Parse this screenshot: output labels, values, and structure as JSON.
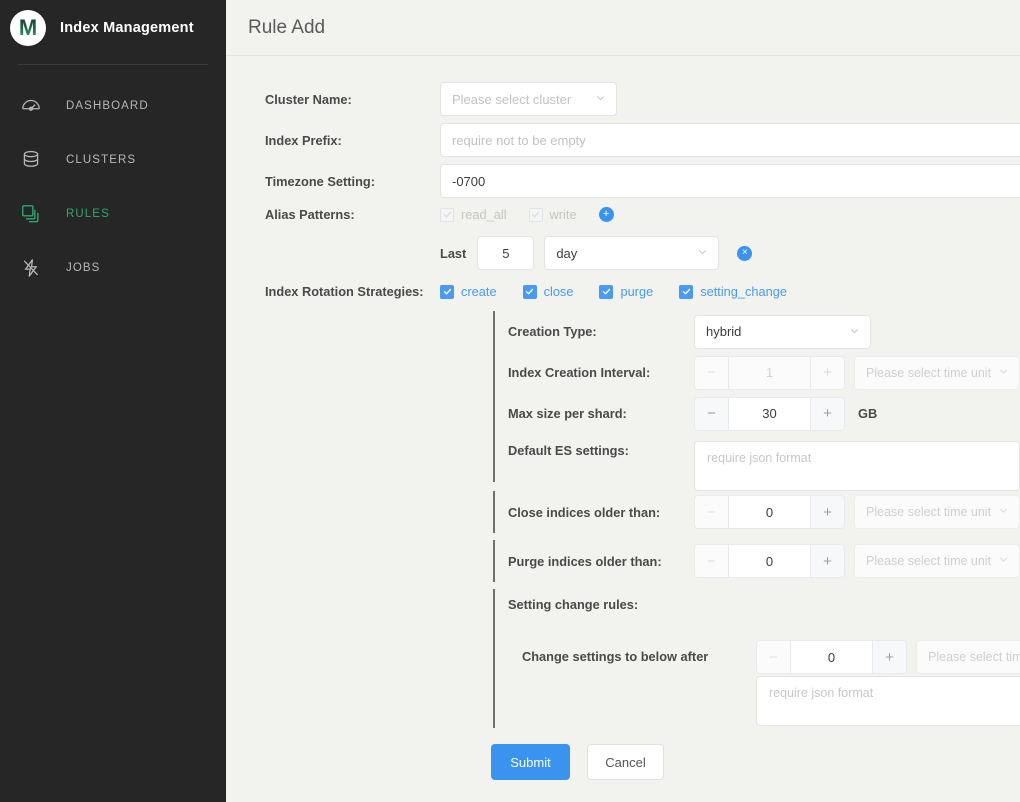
{
  "sidebar": {
    "brand": {
      "logo_letter": "M",
      "title": "Index Management"
    },
    "items": [
      {
        "label": "DASHBOARD",
        "icon": "gauge-icon",
        "active": false
      },
      {
        "label": "CLUSTERS",
        "icon": "database-icon",
        "active": false
      },
      {
        "label": "RULES",
        "icon": "stacked-squares-icon",
        "active": true
      },
      {
        "label": "JOBS",
        "icon": "lightning-bolt-icon",
        "active": false
      }
    ],
    "active_color": "#2ea86e",
    "background": "#262626"
  },
  "header": {
    "title": "Rule Add"
  },
  "form": {
    "cluster_name": {
      "label": "Cluster Name:",
      "placeholder": "Please select cluster",
      "value": ""
    },
    "index_prefix": {
      "label": "Index Prefix:",
      "placeholder": "require not to be empty",
      "value": ""
    },
    "timezone": {
      "label": "Timezone Setting:",
      "value": "-0700",
      "placeholder": ""
    },
    "alias_patterns": {
      "label": "Alias Patterns:",
      "options": [
        {
          "label": "read_all",
          "checked": true,
          "disabled": true
        },
        {
          "label": "write",
          "checked": true,
          "disabled": true
        }
      ],
      "add_button": "+"
    },
    "last_rule": {
      "prefix_label": "Last",
      "count": "5",
      "unit": "day",
      "remove_button": "×"
    },
    "rotation_strategies": {
      "label": "Index Rotation Strategies:",
      "options": [
        {
          "label": "create",
          "checked": true
        },
        {
          "label": "close",
          "checked": true
        },
        {
          "label": "purge",
          "checked": true
        },
        {
          "label": "setting_change",
          "checked": true
        }
      ],
      "checked_color": "#4a9aef"
    },
    "creation_group": {
      "creation_type": {
        "label": "Creation Type:",
        "value": "hybrid"
      },
      "creation_interval": {
        "label": "Index Creation Interval:",
        "value": "1",
        "unit_placeholder": "Please select time unit",
        "disabled": true,
        "minus": "−",
        "plus": "+"
      },
      "max_size_per_shard": {
        "label": "Max size per shard:",
        "value": "30",
        "unit": "GB",
        "minus": "−",
        "plus": "+"
      },
      "default_es_settings": {
        "label": "Default ES settings:",
        "placeholder": "require json format",
        "value": ""
      }
    },
    "close_indices": {
      "label": "Close indices older than:",
      "value": "0",
      "unit_placeholder": "Please select time unit",
      "minus": "−",
      "plus": "+"
    },
    "purge_indices": {
      "label": "Purge indices older than:",
      "value": "0",
      "unit_placeholder": "Please select time unit",
      "minus": "−",
      "plus": "+"
    },
    "setting_change_rules": {
      "label": "Setting change rules:",
      "change_after_label": "Change settings to below after",
      "value": "0",
      "unit_placeholder": "Please select time unit",
      "json_placeholder": "require json format",
      "json_value": "",
      "minus": "−",
      "plus": "+"
    }
  },
  "footer": {
    "submit_label": "Submit",
    "cancel_label": "Cancel",
    "primary_color": "#3b93f0"
  }
}
